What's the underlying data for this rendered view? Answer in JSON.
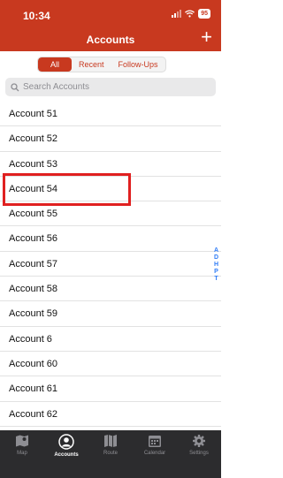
{
  "status": {
    "time": "10:34",
    "battery": "95"
  },
  "header": {
    "title": "Accounts",
    "add": "+"
  },
  "segments": [
    "All",
    "Recent",
    "Follow-Ups"
  ],
  "search": {
    "placeholder": "Search Accounts"
  },
  "accounts": [
    "Account 51",
    "Account 52",
    "Account 53",
    "Account 54",
    "Account 55",
    "Account 56",
    "Account 57",
    "Account 58",
    "Account 59",
    "Account 6",
    "Account 60",
    "Account 61",
    "Account 62"
  ],
  "index_letters": [
    "A",
    "D",
    "H",
    "P",
    "T"
  ],
  "tabs": [
    "Map",
    "Accounts",
    "Route",
    "Calendar",
    "Settings"
  ],
  "colors": {
    "brand": "#c8391f",
    "highlight": "#e02020",
    "index": "#2f7cf6"
  }
}
